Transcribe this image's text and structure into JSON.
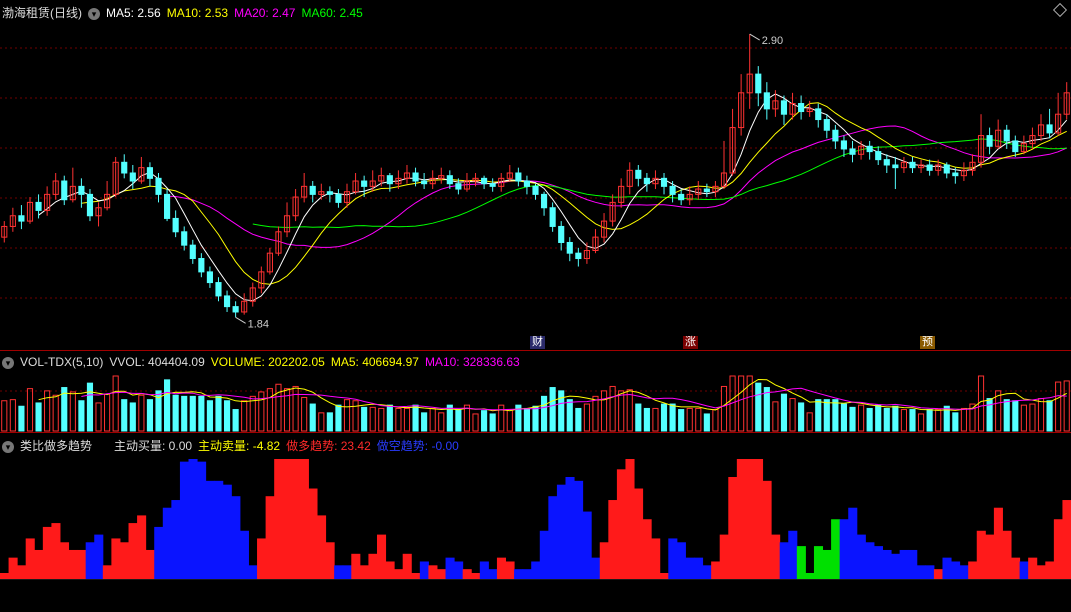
{
  "price_panel": {
    "stock_title": "渤海租赁(日线)",
    "ma5": "MA5: 2.56",
    "ma10": "MA10: 2.53",
    "ma20": "MA20: 2.47",
    "ma60": "MA60: 2.45",
    "high_label": "2.90",
    "low_label": "1.84",
    "events": [
      "财",
      "涨",
      "预"
    ],
    "colors": {
      "ma5": "#ffffff",
      "ma10": "#ffff00",
      "ma20": "#ff00ff",
      "ma60": "#00ff00",
      "up": "#ff3232",
      "down": "#54ffff"
    }
  },
  "volume_panel": {
    "indicator": "VOL-TDX(5,10)",
    "vvol": "VVOL: 404404.09",
    "volume": "VOLUME: 202202.05",
    "ma5": "MA5: 406694.97",
    "ma10": "MA10: 328336.63"
  },
  "trend_panel": {
    "indicator": "类比做多趋势",
    "buy": "主动买量: 0.00",
    "sell": "主动卖量: -4.82",
    "long_trend": "做多趋势: 23.42",
    "short_trend": "做空趋势: -0.00",
    "colors": {
      "long": "#ff1a1a",
      "short": "#0a14ff",
      "neutral": "#00e000"
    }
  },
  "chart_data": {
    "type": "candlestick",
    "candles": [
      [
        2.14,
        2.18,
        2.2,
        2.12
      ],
      [
        2.18,
        2.22,
        2.25,
        2.16
      ],
      [
        2.22,
        2.2,
        2.26,
        2.17
      ],
      [
        2.2,
        2.27,
        2.29,
        2.19
      ],
      [
        2.27,
        2.24,
        2.3,
        2.21
      ],
      [
        2.24,
        2.3,
        2.33,
        2.22
      ],
      [
        2.3,
        2.35,
        2.38,
        2.28
      ],
      [
        2.35,
        2.28,
        2.37,
        2.26
      ],
      [
        2.28,
        2.33,
        2.4,
        2.27
      ],
      [
        2.33,
        2.3,
        2.36,
        2.25
      ],
      [
        2.3,
        2.22,
        2.32,
        2.2
      ],
      [
        2.22,
        2.25,
        2.27,
        2.18
      ],
      [
        2.25,
        2.3,
        2.35,
        2.24
      ],
      [
        2.3,
        2.42,
        2.44,
        2.29
      ],
      [
        2.42,
        2.38,
        2.45,
        2.36
      ],
      [
        2.38,
        2.35,
        2.41,
        2.32
      ],
      [
        2.35,
        2.4,
        2.44,
        2.34
      ],
      [
        2.4,
        2.36,
        2.42,
        2.33
      ],
      [
        2.36,
        2.3,
        2.38,
        2.27
      ],
      [
        2.3,
        2.21,
        2.32,
        2.2
      ],
      [
        2.21,
        2.16,
        2.24,
        2.14
      ],
      [
        2.16,
        2.11,
        2.18,
        2.09
      ],
      [
        2.11,
        2.06,
        2.13,
        2.04
      ],
      [
        2.06,
        2.01,
        2.08,
        1.99
      ],
      [
        2.01,
        1.97,
        2.03,
        1.95
      ],
      [
        1.97,
        1.92,
        1.99,
        1.9
      ],
      [
        1.92,
        1.88,
        1.94,
        1.86
      ],
      [
        1.88,
        1.86,
        1.9,
        1.84
      ],
      [
        1.86,
        1.9,
        1.93,
        1.85
      ],
      [
        1.9,
        1.95,
        1.97,
        1.88
      ],
      [
        1.95,
        2.01,
        2.03,
        1.93
      ],
      [
        2.01,
        2.08,
        2.1,
        2.0
      ],
      [
        2.08,
        2.16,
        2.18,
        2.07
      ],
      [
        2.16,
        2.22,
        2.27,
        2.14
      ],
      [
        2.22,
        2.29,
        2.32,
        2.2
      ],
      [
        2.29,
        2.33,
        2.38,
        2.27
      ],
      [
        2.33,
        2.3,
        2.35,
        2.27
      ],
      [
        2.3,
        2.31,
        2.34,
        2.28
      ],
      [
        2.31,
        2.3,
        2.33,
        2.27
      ],
      [
        2.3,
        2.27,
        2.32,
        2.25
      ],
      [
        2.27,
        2.31,
        2.34,
        2.25
      ],
      [
        2.31,
        2.35,
        2.38,
        2.3
      ],
      [
        2.35,
        2.33,
        2.37,
        2.29
      ],
      [
        2.33,
        2.35,
        2.39,
        2.31
      ],
      [
        2.35,
        2.37,
        2.4,
        2.33
      ],
      [
        2.37,
        2.34,
        2.38,
        2.31
      ],
      [
        2.34,
        2.36,
        2.39,
        2.32
      ],
      [
        2.36,
        2.38,
        2.41,
        2.34
      ],
      [
        2.38,
        2.35,
        2.4,
        2.33
      ],
      [
        2.35,
        2.34,
        2.38,
        2.32
      ],
      [
        2.34,
        2.36,
        2.39,
        2.32
      ],
      [
        2.36,
        2.37,
        2.4,
        2.34
      ],
      [
        2.37,
        2.34,
        2.39,
        2.32
      ],
      [
        2.34,
        2.32,
        2.36,
        2.3
      ],
      [
        2.32,
        2.35,
        2.38,
        2.31
      ],
      [
        2.35,
        2.36,
        2.38,
        2.33
      ],
      [
        2.36,
        2.34,
        2.37,
        2.32
      ],
      [
        2.34,
        2.33,
        2.36,
        2.31
      ],
      [
        2.33,
        2.36,
        2.38,
        2.31
      ],
      [
        2.36,
        2.38,
        2.41,
        2.35
      ],
      [
        2.38,
        2.35,
        2.4,
        2.33
      ],
      [
        2.35,
        2.33,
        2.37,
        2.3
      ],
      [
        2.33,
        2.3,
        2.34,
        2.28
      ],
      [
        2.3,
        2.25,
        2.31,
        2.22
      ],
      [
        2.25,
        2.18,
        2.27,
        2.16
      ],
      [
        2.18,
        2.12,
        2.2,
        2.09
      ],
      [
        2.12,
        2.08,
        2.14,
        2.05
      ],
      [
        2.08,
        2.06,
        2.1,
        2.03
      ],
      [
        2.06,
        2.09,
        2.12,
        2.04
      ],
      [
        2.09,
        2.14,
        2.17,
        2.08
      ],
      [
        2.14,
        2.2,
        2.23,
        2.12
      ],
      [
        2.2,
        2.27,
        2.3,
        2.18
      ],
      [
        2.27,
        2.33,
        2.36,
        2.25
      ],
      [
        2.33,
        2.39,
        2.42,
        2.3
      ],
      [
        2.39,
        2.36,
        2.41,
        2.33
      ],
      [
        2.36,
        2.34,
        2.38,
        2.31
      ],
      [
        2.34,
        2.36,
        2.39,
        2.32
      ],
      [
        2.36,
        2.33,
        2.38,
        2.3
      ],
      [
        2.33,
        2.3,
        2.35,
        2.27
      ],
      [
        2.3,
        2.28,
        2.32,
        2.26
      ],
      [
        2.28,
        2.3,
        2.33,
        2.26
      ],
      [
        2.3,
        2.32,
        2.35,
        2.28
      ],
      [
        2.32,
        2.31,
        2.34,
        2.29
      ],
      [
        2.31,
        2.33,
        2.35,
        2.29
      ],
      [
        2.33,
        2.38,
        2.5,
        2.32
      ],
      [
        2.38,
        2.55,
        2.62,
        2.37
      ],
      [
        2.55,
        2.68,
        2.75,
        2.52
      ],
      [
        2.68,
        2.75,
        2.9,
        2.62
      ],
      [
        2.75,
        2.68,
        2.78,
        2.63
      ],
      [
        2.68,
        2.62,
        2.72,
        2.58
      ],
      [
        2.62,
        2.65,
        2.69,
        2.59
      ],
      [
        2.65,
        2.6,
        2.67,
        2.56
      ],
      [
        2.6,
        2.64,
        2.68,
        2.58
      ],
      [
        2.64,
        2.61,
        2.67,
        2.58
      ],
      [
        2.61,
        2.62,
        2.65,
        2.59
      ],
      [
        2.62,
        2.58,
        2.64,
        2.55
      ],
      [
        2.58,
        2.54,
        2.6,
        2.51
      ],
      [
        2.54,
        2.5,
        2.56,
        2.47
      ],
      [
        2.5,
        2.47,
        2.52,
        2.44
      ],
      [
        2.47,
        2.45,
        2.5,
        2.42
      ],
      [
        2.45,
        2.48,
        2.5,
        2.43
      ],
      [
        2.48,
        2.46,
        2.5,
        2.43
      ],
      [
        2.46,
        2.43,
        2.48,
        2.41
      ],
      [
        2.43,
        2.41,
        2.45,
        2.38
      ],
      [
        2.41,
        2.4,
        2.44,
        2.32
      ],
      [
        2.4,
        2.42,
        2.44,
        2.38
      ],
      [
        2.42,
        2.4,
        2.44,
        2.38
      ],
      [
        2.4,
        2.41,
        2.43,
        2.38
      ],
      [
        2.41,
        2.39,
        2.43,
        2.37
      ],
      [
        2.39,
        2.41,
        2.43,
        2.37
      ],
      [
        2.41,
        2.38,
        2.42,
        2.36
      ],
      [
        2.38,
        2.37,
        2.4,
        2.34
      ],
      [
        2.37,
        2.39,
        2.42,
        2.35
      ],
      [
        2.39,
        2.42,
        2.45,
        2.37
      ],
      [
        2.42,
        2.52,
        2.6,
        2.4
      ],
      [
        2.52,
        2.48,
        2.55,
        2.45
      ],
      [
        2.48,
        2.54,
        2.58,
        2.47
      ],
      [
        2.54,
        2.5,
        2.56,
        2.47
      ],
      [
        2.5,
        2.46,
        2.52,
        2.44
      ],
      [
        2.46,
        2.49,
        2.52,
        2.45
      ],
      [
        2.49,
        2.52,
        2.55,
        2.47
      ],
      [
        2.52,
        2.56,
        2.6,
        2.5
      ],
      [
        2.56,
        2.53,
        2.62,
        2.51
      ],
      [
        2.53,
        2.6,
        2.68,
        2.52
      ],
      [
        2.6,
        2.68,
        2.72,
        2.58
      ]
    ]
  }
}
